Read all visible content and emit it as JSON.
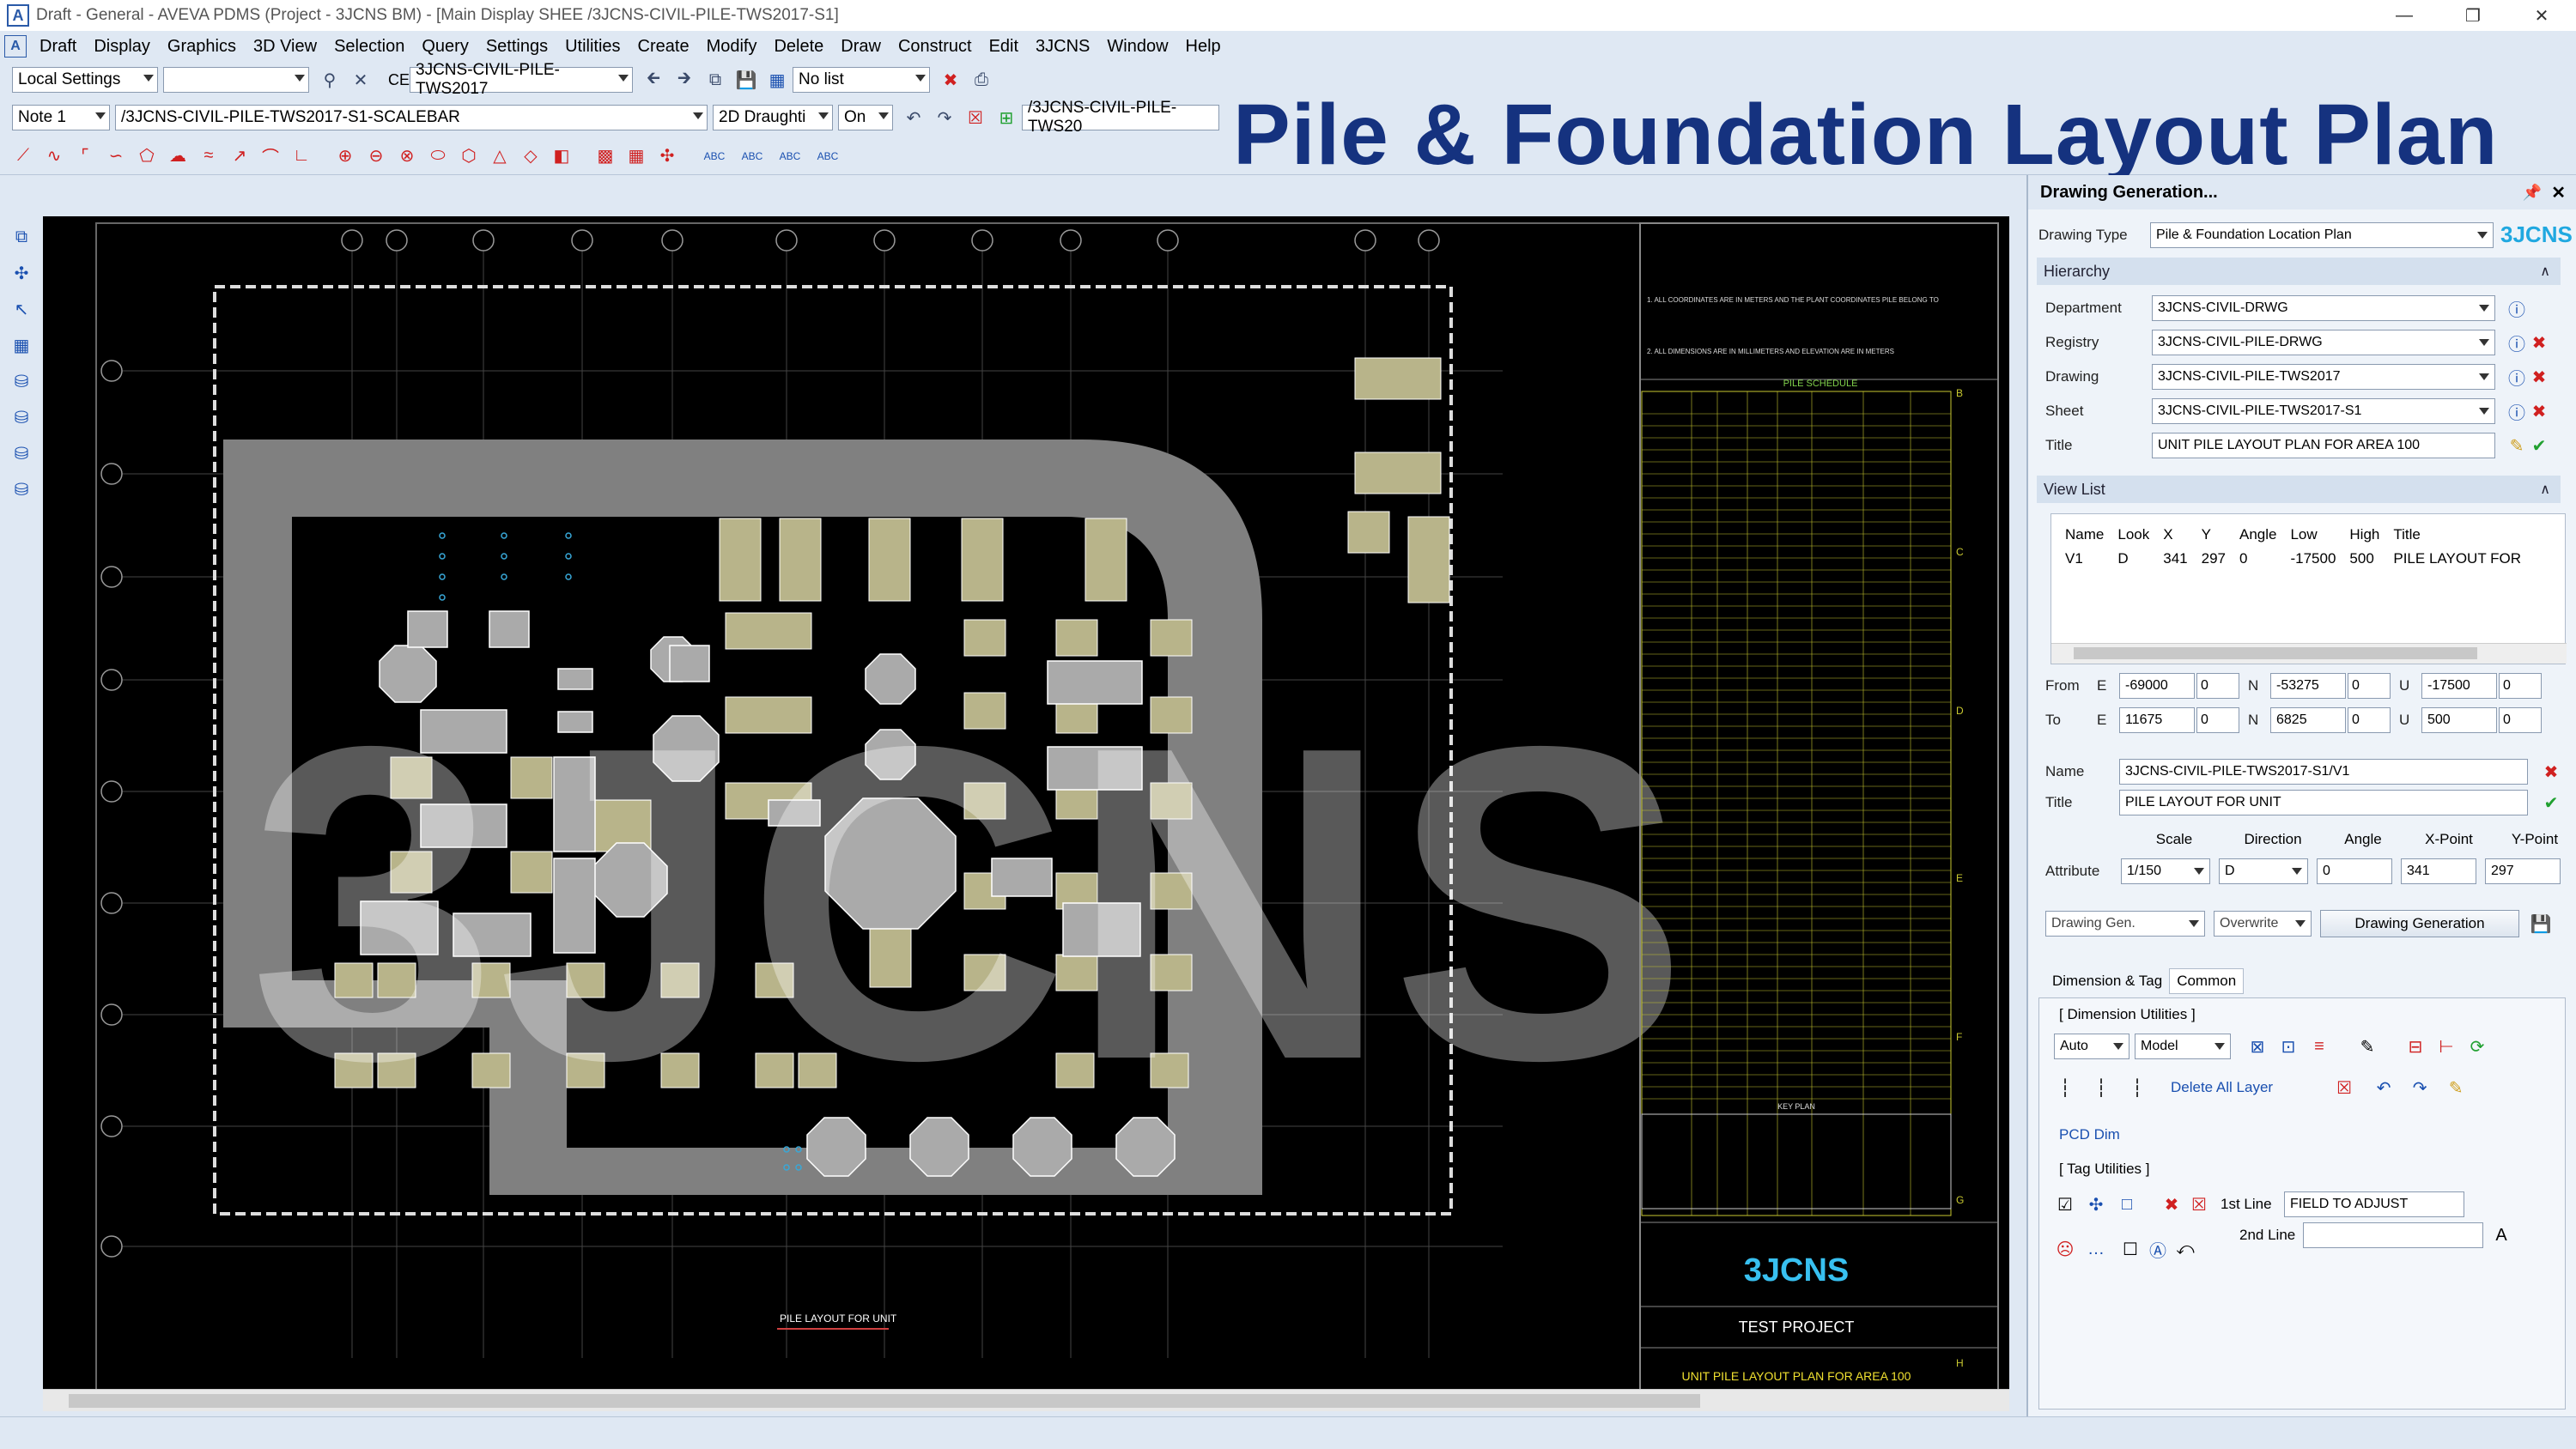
{
  "titlebar": {
    "text": "Draft - General - AVEVA PDMS (Project - 3JCNS BM) - [Main Display  SHEE  /3JCNS-CIVIL-PILE-TWS2017-S1]",
    "app_icon": "A"
  },
  "menu": [
    "Draft",
    "Display",
    "Graphics",
    "3D View",
    "Selection",
    "Query",
    "Settings",
    "Utilities",
    "Create",
    "Modify",
    "Delete",
    "Draw",
    "Construct",
    "Edit",
    "3JCNS",
    "Window",
    "Help"
  ],
  "toolbar1": {
    "local_settings": "Local Settings",
    "ce_label": "CE",
    "ce_value": "3JCNS-CIVIL-PILE-TWS2017",
    "list_value": "No list"
  },
  "toolbar2": {
    "note": "Note 1",
    "path": "/3JCNS-CIVIL-PILE-TWS2017-S1-SCALEBAR",
    "mode": "2D Draughti",
    "on": "On",
    "view_path": "/3JCNS-CIVIL-PILE-TWS20"
  },
  "overlay_title": "Pile & Foundation Layout Plan",
  "drawing": {
    "watermark": "3JCNS",
    "view_caption": "PILE LAYOUT FOR UNIT",
    "schedule_title": "PILE SCHEDULE",
    "key_plan": "KEY PLAN",
    "logo": "3JCNS",
    "project": "TEST PROJECT",
    "sheet_title": "UNIT PILE LAYOUT PLAN FOR AREA 100",
    "notes": [
      "1. ALL COORDINATES ARE IN METERS AND THE PLANT COORDINATES PILE BELONG TO",
      "2. ALL DIMENSIONS ARE IN MILLIMETERS AND ELEVATION ARE IN METERS"
    ],
    "border_letters": [
      "B",
      "C",
      "D",
      "E",
      "F",
      "G",
      "H"
    ]
  },
  "panel": {
    "header": "Drawing Generation...",
    "drawing_type_label": "Drawing Type",
    "drawing_type": "Pile & Foundation Location Plan",
    "brand": "3JCNS",
    "hierarchy_label": "Hierarchy",
    "department_label": "Department",
    "department": "3JCNS-CIVIL-DRWG",
    "registry_label": "Registry",
    "registry": "3JCNS-CIVIL-PILE-DRWG",
    "drawing_label": "Drawing",
    "drawing": "3JCNS-CIVIL-PILE-TWS2017",
    "sheet_label": "Sheet",
    "sheet": "3JCNS-CIVIL-PILE-TWS2017-S1",
    "title_label": "Title",
    "title": "UNIT PILE LAYOUT PLAN FOR AREA 100",
    "viewlist_label": "View List",
    "view_columns": [
      "Name",
      "Look",
      "X",
      "Y",
      "Angle",
      "Low",
      "High",
      "Title"
    ],
    "view_rows": [
      [
        "V1",
        "D",
        "341",
        "297",
        "0",
        "-17500",
        "500",
        "PILE LAYOUT FOR"
      ]
    ],
    "from_label": "From",
    "to_label": "To",
    "from": {
      "e": "-69000",
      "e2": "0",
      "n": "-53275",
      "n2": "0",
      "u": "-17500",
      "u2": "0"
    },
    "to": {
      "e": "11675",
      "e2": "0",
      "n": "6825",
      "n2": "0",
      "u": "500",
      "u2": "0"
    },
    "axis_e": "E",
    "axis_n": "N",
    "axis_u": "U",
    "name_label": "Name",
    "name": "3JCNS-CIVIL-PILE-TWS2017-S1/V1",
    "vtitle_label": "Title",
    "vtitle": "PILE LAYOUT FOR UNIT",
    "attr_headers": [
      "Scale",
      "Direction",
      "Angle",
      "X-Point",
      "Y-Point"
    ],
    "attribute_label": "Attribute",
    "scale": "1/150",
    "direction": "D",
    "angle": "0",
    "xpoint": "341",
    "ypoint": "297",
    "gen_mode": "Drawing Gen.",
    "overwrite": "Overwrite",
    "gen_button": "Drawing Generation",
    "tabs": [
      "Dimension & Tag",
      "Common"
    ],
    "dim_utils": "[ Dimension Utilities ]",
    "dim_auto": "Auto",
    "dim_model": "Model",
    "delete_all_layer": "Delete All Layer",
    "pcd_dim": "PCD Dim",
    "tag_utils": "[ Tag Utilities ]",
    "first_line_label": "1st Line",
    "first_line": "FIELD TO ADJUST",
    "second_line_label": "2nd Line",
    "second_line": ""
  }
}
